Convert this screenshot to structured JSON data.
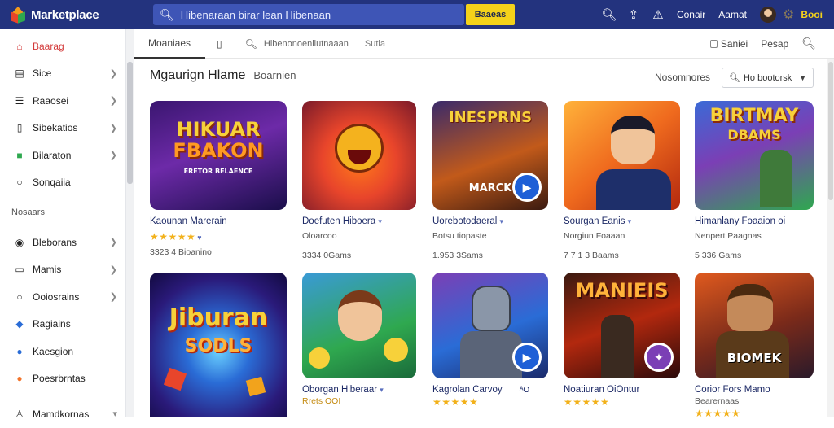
{
  "app": {
    "brand": "Marketplace",
    "search_placeholder": "Hibenaraan birar lean Hibenaan",
    "search_button": "Baaeas",
    "top_links": [
      "Conair",
      "Aamat"
    ],
    "top_brand": "Booi"
  },
  "sidebar": {
    "items": [
      {
        "label": "Baarag",
        "icon": "home-icon",
        "color": "#d33a3a"
      },
      {
        "label": "Sice",
        "icon": "grid-icon"
      },
      {
        "label": "Raaosei",
        "icon": "list-icon"
      },
      {
        "label": "Sibekatios",
        "icon": "tablet-icon"
      },
      {
        "label": "Bilaraton",
        "icon": "book-icon",
        "color": "#2fa84f"
      },
      {
        "label": "Sonqaiia",
        "icon": "chat-icon"
      }
    ],
    "section_heading": "Nosaars",
    "items2": [
      {
        "label": "Bleborans",
        "icon": "pin-icon"
      },
      {
        "label": "Mamis",
        "icon": "card-icon"
      },
      {
        "label": "Ooiosrains",
        "icon": "search-icon"
      },
      {
        "label": "Ragiains",
        "icon": "shield-icon",
        "color": "#2a6cd6"
      },
      {
        "label": "Kaesgion",
        "icon": "globe-icon",
        "color": "#2a6cd6"
      },
      {
        "label": "Poesrbrntas",
        "icon": "circle-icon",
        "color": "#f3742a"
      }
    ],
    "footer_item": "Mamdkornas"
  },
  "tabs": {
    "active": "Moaniaes",
    "search_text": "Hibenonoenilutnaaan",
    "extra": "Sutia",
    "right_a": "Saniei",
    "right_b": "Pesap"
  },
  "main": {
    "heading": "Mgaurign Hlame",
    "subheading": "Boarnien",
    "sort_label": "Nosomnores",
    "sort_value": "Ho bootorsk"
  },
  "cards": [
    {
      "title": "Kaounan Marerain",
      "stars": "★★★★★",
      "rating_extra": "♥",
      "meta": "3323 4 Bioanino",
      "art": "HIKUAR FBAKON",
      "art_sub": "ERETOR BELAENCE",
      "accent": "#e8452b"
    },
    {
      "title": "Doefuten Hiboera",
      "stars": "",
      "rating_extra": "",
      "title_extra": "▾",
      "meta_top": "Oloarcoo",
      "meta": "3334 0Gams",
      "art": "",
      "accent": "#f2a31c"
    },
    {
      "title": "Uorebotodaeral",
      "stars": "",
      "rating_extra": "",
      "title_extra": "▾",
      "meta_top": "Botsu tiopaste",
      "meta": "1.953 3Sams",
      "art": "INESPRNS",
      "art_sub": "MARCK",
      "accent": "#2a6cd6"
    },
    {
      "title": "Sourgan Eanis",
      "stars": "",
      "rating_extra": "",
      "title_extra": "▾",
      "meta_top": "Norgiun Foaaan",
      "meta": "7 7 1 3 Baams",
      "art": "",
      "accent": "#e05a1e"
    },
    {
      "title": "Himanlany Foaaion oi",
      "stars": "",
      "rating_extra": "",
      "meta_top": "Nenpert Paagnas",
      "meta": "5 336 Gams",
      "art": "BIRTMAY DBAMS",
      "accent": "#2fa84f"
    },
    {
      "title": "",
      "stars": "",
      "rating_extra": "",
      "meta": "",
      "art": "Jiburan SODLS",
      "accent": "#f4d21a"
    },
    {
      "title": "Oborgan Hiberaar",
      "stars": "",
      "rating_extra": "",
      "title_extra": "▾",
      "meta_top": "Rrets OOI",
      "meta": "",
      "art": "",
      "accent": "#2a6cd6"
    },
    {
      "title": "Kagrolan Carvoy",
      "stars": "★★★★★",
      "rating_extra": "",
      "title_extra": "ᴬO",
      "meta": "",
      "art": "",
      "accent": "#2a6cd6"
    },
    {
      "title": "Noatiuran OiOntur",
      "stars": "★★★★★",
      "rating_extra": "",
      "meta": "",
      "art": "MANIEIS",
      "accent": "#7b3fb5"
    },
    {
      "title": "Corior Fors Mamo",
      "stars": "★★★★★",
      "rating_extra": "",
      "meta_top": "Bearernaas",
      "meta": "",
      "art": "BIOMEK",
      "accent": "#c46a1f"
    }
  ]
}
